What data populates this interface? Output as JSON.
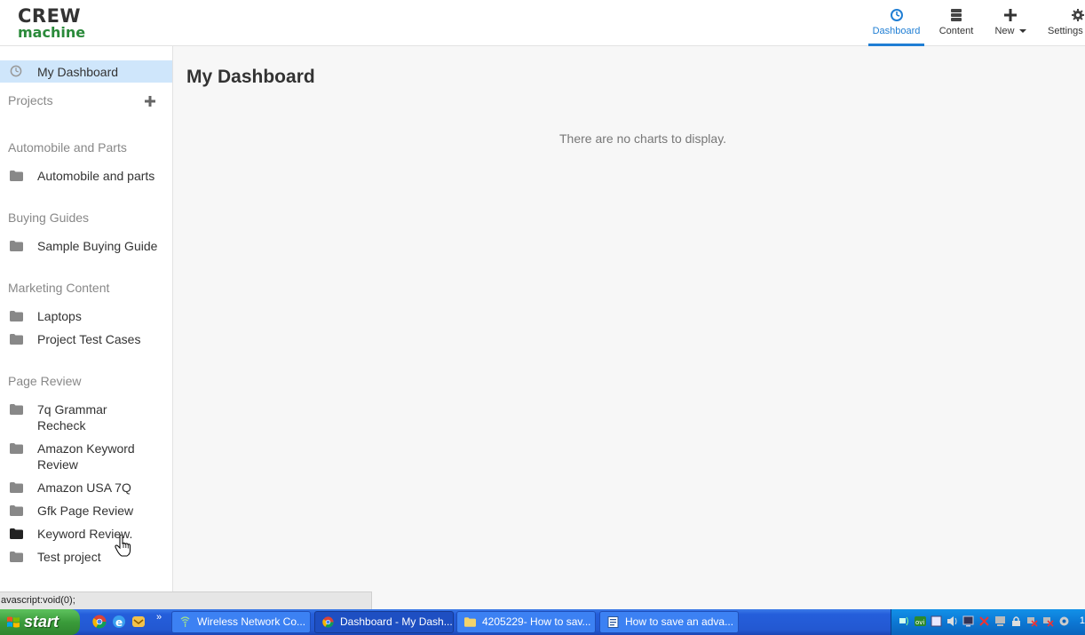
{
  "header": {
    "logo_line1": "CREW",
    "logo_line2": "machine",
    "nav": [
      {
        "label": "Dashboard",
        "icon": "dashboard-icon"
      },
      {
        "label": "Content",
        "icon": "content-icon"
      },
      {
        "label": "New",
        "icon": "plus-icon"
      },
      {
        "label": "Settings",
        "icon": "gear-icon"
      }
    ]
  },
  "sidebar": {
    "dashboard_label": "My Dashboard",
    "projects_label": "Projects",
    "sections": [
      {
        "title": "Automobile and Parts",
        "items": [
          "Automobile and parts"
        ]
      },
      {
        "title": "Buying Guides",
        "items": [
          "Sample Buying Guide"
        ]
      },
      {
        "title": "Marketing Content",
        "items": [
          "Laptops",
          "Project Test Cases"
        ]
      },
      {
        "title": "Page Review",
        "items": [
          "7q Grammar Recheck",
          "Amazon Keyword Review",
          "Amazon USA 7Q",
          "Gfk Page Review",
          "Keyword Review.",
          "Test project"
        ]
      }
    ]
  },
  "main": {
    "title": "My Dashboard",
    "empty_message": "There are no charts to display."
  },
  "statusbar": {
    "text": "avascript:void(0);"
  },
  "taskbar": {
    "start_label": "start",
    "tasks": [
      {
        "label": "Wireless Network Co..."
      },
      {
        "label": "Dashboard - My Dash..."
      },
      {
        "label": "4205229- How to sav..."
      },
      {
        "label": "How to save an adva..."
      }
    ],
    "clock": "1"
  },
  "colors": {
    "accent": "#1f7ed4",
    "active_row": "#cfe6fb",
    "logo_green": "#2a8a3a",
    "taskbar_blue": "#245edb"
  }
}
